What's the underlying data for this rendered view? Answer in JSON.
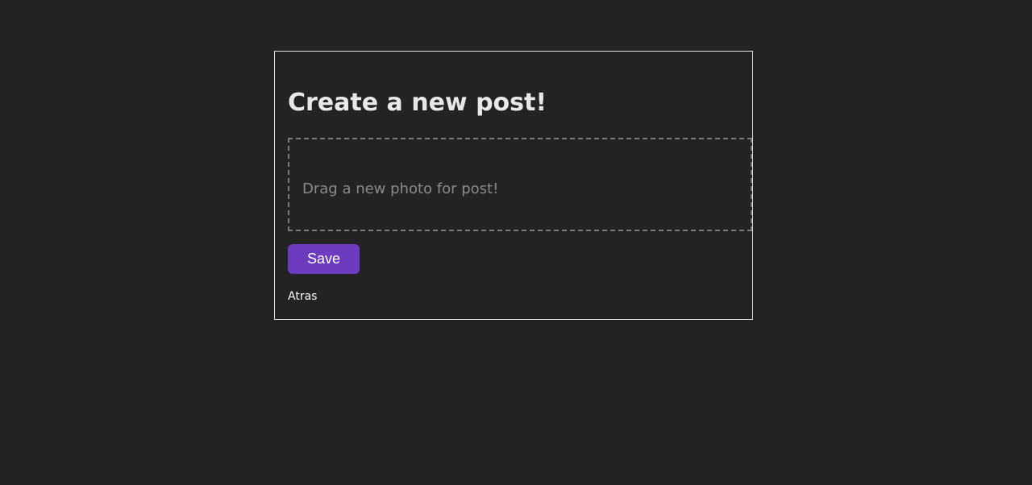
{
  "page": {
    "background": "#232323"
  },
  "form": {
    "title": "Create a new post!",
    "dropzone_text": "Drag a new photo for post!",
    "save_label": "Save",
    "back_label": "Atras",
    "accent_color": "#6c3bbf"
  }
}
